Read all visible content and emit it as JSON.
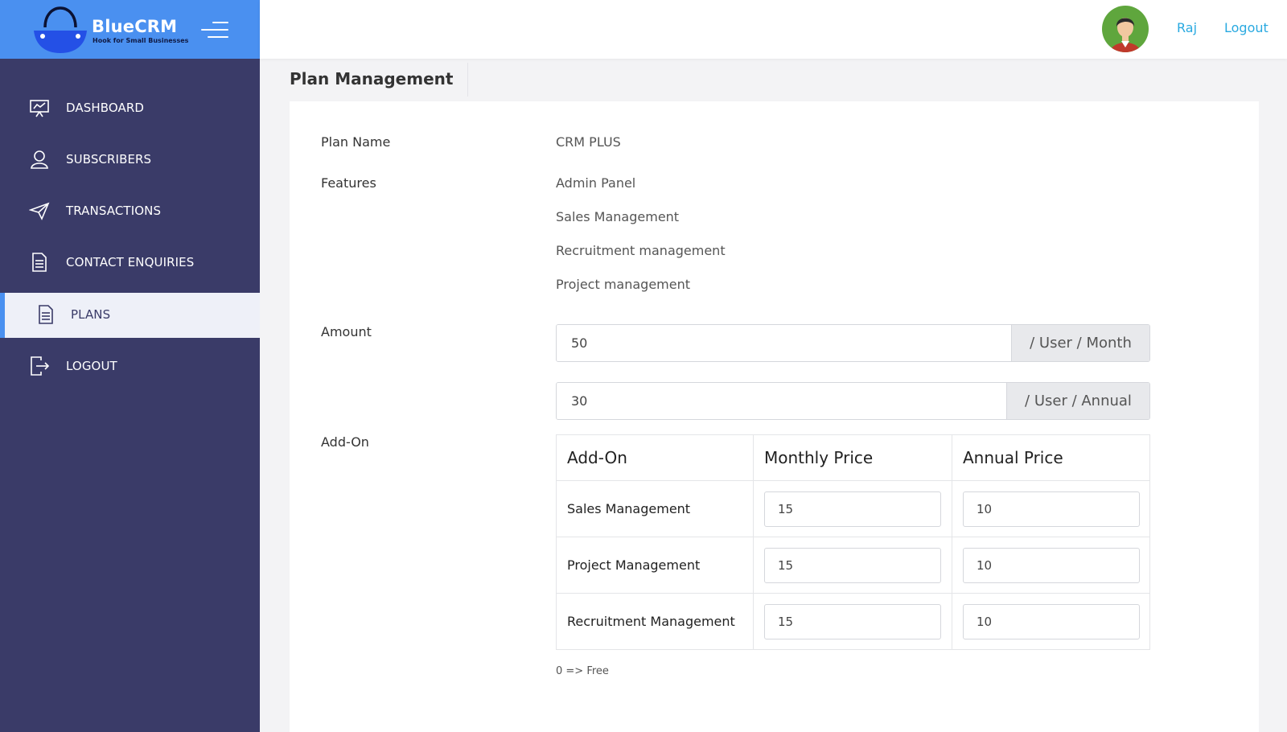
{
  "brand": {
    "name": "BlueCRM",
    "tagline": "Hook for Small Businesses"
  },
  "sidebar": {
    "items": [
      {
        "label": "DASHBOARD",
        "icon": "presentation-chart-icon"
      },
      {
        "label": "SUBSCRIBERS",
        "icon": "user-icon"
      },
      {
        "label": "TRANSACTIONS",
        "icon": "paper-plane-icon"
      },
      {
        "label": "CONTACT ENQUIRIES",
        "icon": "document-icon"
      },
      {
        "label": "PLANS",
        "icon": "document-icon",
        "active": true
      },
      {
        "label": "LOGOUT",
        "icon": "logout-icon"
      }
    ]
  },
  "header": {
    "user_name": "Raj",
    "logout_label": "Logout"
  },
  "page": {
    "title": "Plan Management"
  },
  "plan": {
    "name_label": "Plan Name",
    "name_value": "CRM PLUS",
    "features_label": "Features",
    "features": [
      "Admin Panel",
      "Sales Management",
      "Recruitment management",
      "Project management"
    ],
    "amount_label": "Amount",
    "monthly_amount": "50",
    "monthly_suffix": "/ User / Month",
    "annual_amount": "30",
    "annual_suffix": "/ User / Annual",
    "addon_label": "Add-On"
  },
  "addons": {
    "headers": [
      "Add-On",
      "Monthly Price",
      "Annual Price"
    ],
    "rows": [
      {
        "name": "Sales Management",
        "monthly": "15",
        "annual": "10"
      },
      {
        "name": "Project Management",
        "monthly": "15",
        "annual": "10"
      },
      {
        "name": "Recruitment Management",
        "monthly": "15",
        "annual": "10"
      }
    ],
    "note": "0 => Free"
  },
  "colors": {
    "brand_blue": "#4a90f0",
    "sidebar_bg": "#3a3b68",
    "link_blue": "#29a9e0"
  }
}
